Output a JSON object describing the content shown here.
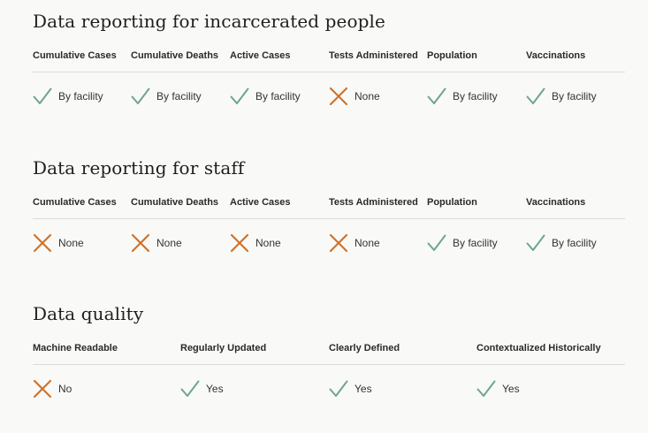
{
  "colors": {
    "check": "#6fa58c",
    "cross": "#d0722c"
  },
  "incarcerated": {
    "title": "Data reporting for incarcerated people",
    "columns": [
      {
        "label": "Cumulative Cases",
        "status": "check",
        "value": "By facility"
      },
      {
        "label": "Cumulative Deaths",
        "status": "check",
        "value": "By facility"
      },
      {
        "label": "Active Cases",
        "status": "check",
        "value": "By facility"
      },
      {
        "label": "Tests Administered",
        "status": "cross",
        "value": "None"
      },
      {
        "label": "Population",
        "status": "check",
        "value": "By facility"
      },
      {
        "label": "Vaccinations",
        "status": "check",
        "value": "By facility"
      }
    ]
  },
  "staff": {
    "title": "Data reporting for staff",
    "columns": [
      {
        "label": "Cumulative Cases",
        "status": "cross",
        "value": "None"
      },
      {
        "label": "Cumulative Deaths",
        "status": "cross",
        "value": "None"
      },
      {
        "label": "Active Cases",
        "status": "cross",
        "value": "None"
      },
      {
        "label": "Tests Administered",
        "status": "cross",
        "value": "None"
      },
      {
        "label": "Population",
        "status": "check",
        "value": "By facility"
      },
      {
        "label": "Vaccinations",
        "status": "check",
        "value": "By facility"
      }
    ]
  },
  "quality": {
    "title": "Data quality",
    "columns": [
      {
        "label": "Machine Readable",
        "status": "cross",
        "value": "No"
      },
      {
        "label": "Regularly Updated",
        "status": "check",
        "value": "Yes"
      },
      {
        "label": "Clearly Defined",
        "status": "check",
        "value": "Yes"
      },
      {
        "label": "Contextualized Historically",
        "status": "check",
        "value": "Yes"
      }
    ]
  }
}
